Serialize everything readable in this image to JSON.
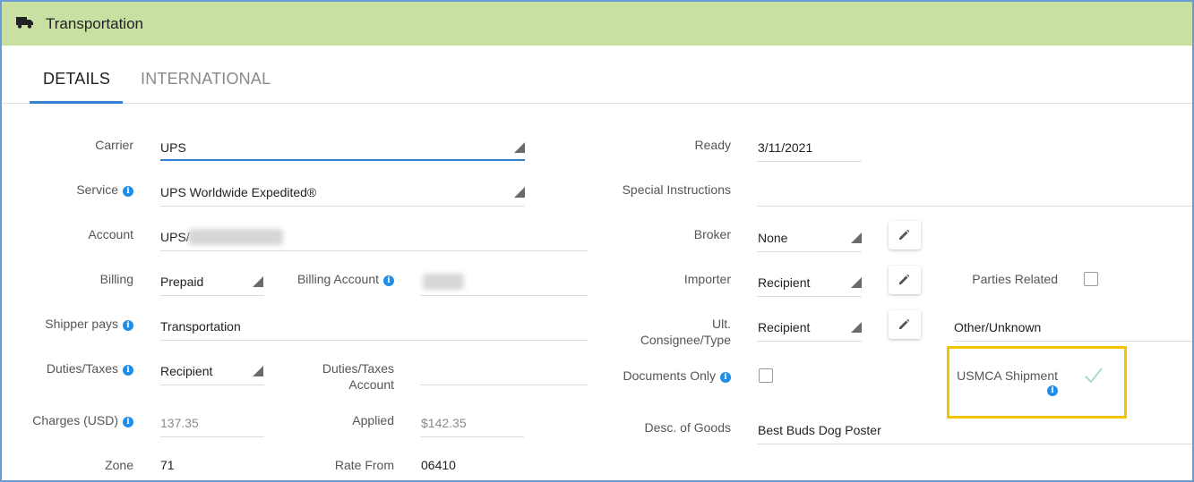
{
  "header": {
    "title": "Transportation",
    "icon": "truck-icon",
    "color": "#c8e0a2"
  },
  "tabs": [
    {
      "label": "DETAILS",
      "active": true
    },
    {
      "label": "INTERNATIONAL",
      "active": false
    }
  ],
  "left": {
    "carrier": {
      "label": "Carrier",
      "value": "UPS"
    },
    "service": {
      "label": "Service",
      "value": "UPS Worldwide Expedited®"
    },
    "account": {
      "label": "Account",
      "value": "UPS/"
    },
    "billing": {
      "label": "Billing",
      "value": "Prepaid"
    },
    "billing_account": {
      "label": "Billing Account"
    },
    "shipper_pays": {
      "label": "Shipper pays",
      "value": "Transportation"
    },
    "duties_taxes": {
      "label": "Duties/Taxes",
      "value": "Recipient"
    },
    "duties_taxes_account": {
      "label_line1": "Duties/Taxes",
      "label_line2": "Account"
    },
    "charges": {
      "label": "Charges (USD)",
      "value": "137.35"
    },
    "applied": {
      "label": "Applied",
      "value": "$142.35"
    },
    "zone": {
      "label": "Zone",
      "value": "71"
    },
    "rate_from": {
      "label": "Rate From",
      "value": "06410"
    }
  },
  "right": {
    "ready": {
      "label": "Ready",
      "value": "3/11/2021"
    },
    "special_instructions": {
      "label": "Special Instructions",
      "value": ""
    },
    "broker": {
      "label": "Broker",
      "value": "None"
    },
    "importer": {
      "label": "Importer",
      "value": "Recipient"
    },
    "parties_related": {
      "label": "Parties Related",
      "checked": false
    },
    "ult_consignee": {
      "label_line1": "Ult.",
      "label_line2": "Consignee/Type",
      "value": "Recipient",
      "type_value": "Other/Unknown"
    },
    "documents_only": {
      "label": "Documents Only",
      "checked": false
    },
    "usmca": {
      "label": "USMCA Shipment",
      "checked": true
    },
    "desc_goods": {
      "label": "Desc. of Goods",
      "value": "Best Buds Dog Poster"
    }
  },
  "colors": {
    "accent": "#2f80d1",
    "info": "#1f8ee8",
    "highlight": "#f4c400",
    "check": "#a8dcc8"
  }
}
